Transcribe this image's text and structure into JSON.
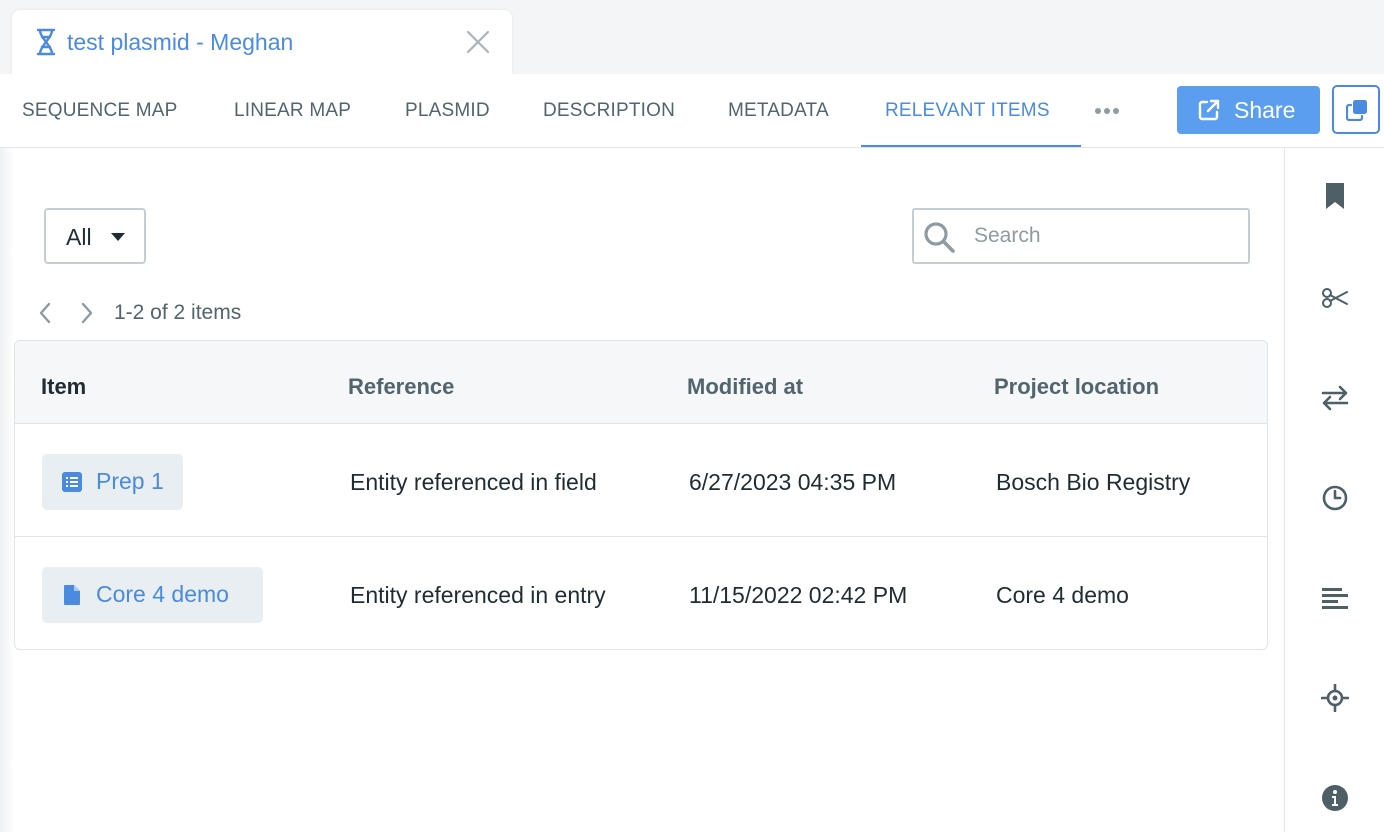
{
  "tab": {
    "title": "test plasmid - Meghan"
  },
  "nav": {
    "tabs": [
      {
        "label": "SEQUENCE MAP"
      },
      {
        "label": "LINEAR MAP"
      },
      {
        "label": "PLASMID"
      },
      {
        "label": "DESCRIPTION"
      },
      {
        "label": "METADATA"
      },
      {
        "label": "RELEVANT ITEMS"
      }
    ],
    "active_tab": "RELEVANT ITEMS",
    "share_label": "Share"
  },
  "filter": {
    "selected": "All"
  },
  "search": {
    "placeholder": "Search",
    "value": ""
  },
  "pager": {
    "text": "1-2 of 2 items"
  },
  "table": {
    "columns": [
      "Item",
      "Reference",
      "Modified at",
      "Project location"
    ],
    "rows": [
      {
        "item": "Prep 1",
        "item_icon": "list-icon",
        "reference": "Entity referenced in field",
        "modified": "6/27/2023 04:35 PM",
        "location": "Bosch Bio Registry"
      },
      {
        "item": "Core 4 demo",
        "item_icon": "document-icon",
        "reference": "Entity referenced in entry",
        "modified": "11/15/2022 02:42 PM",
        "location": "Core 4 demo"
      }
    ]
  },
  "side_rail": {
    "icons": [
      "bookmark-icon",
      "scissors-icon",
      "swap-arrows-icon",
      "clock-icon",
      "align-left-icon",
      "crosshair-icon",
      "info-icon"
    ]
  },
  "colors": {
    "accent": "#4a8be0",
    "share_button": "#5b9ef0",
    "text": "#1f2d33",
    "muted": "#52646c"
  }
}
